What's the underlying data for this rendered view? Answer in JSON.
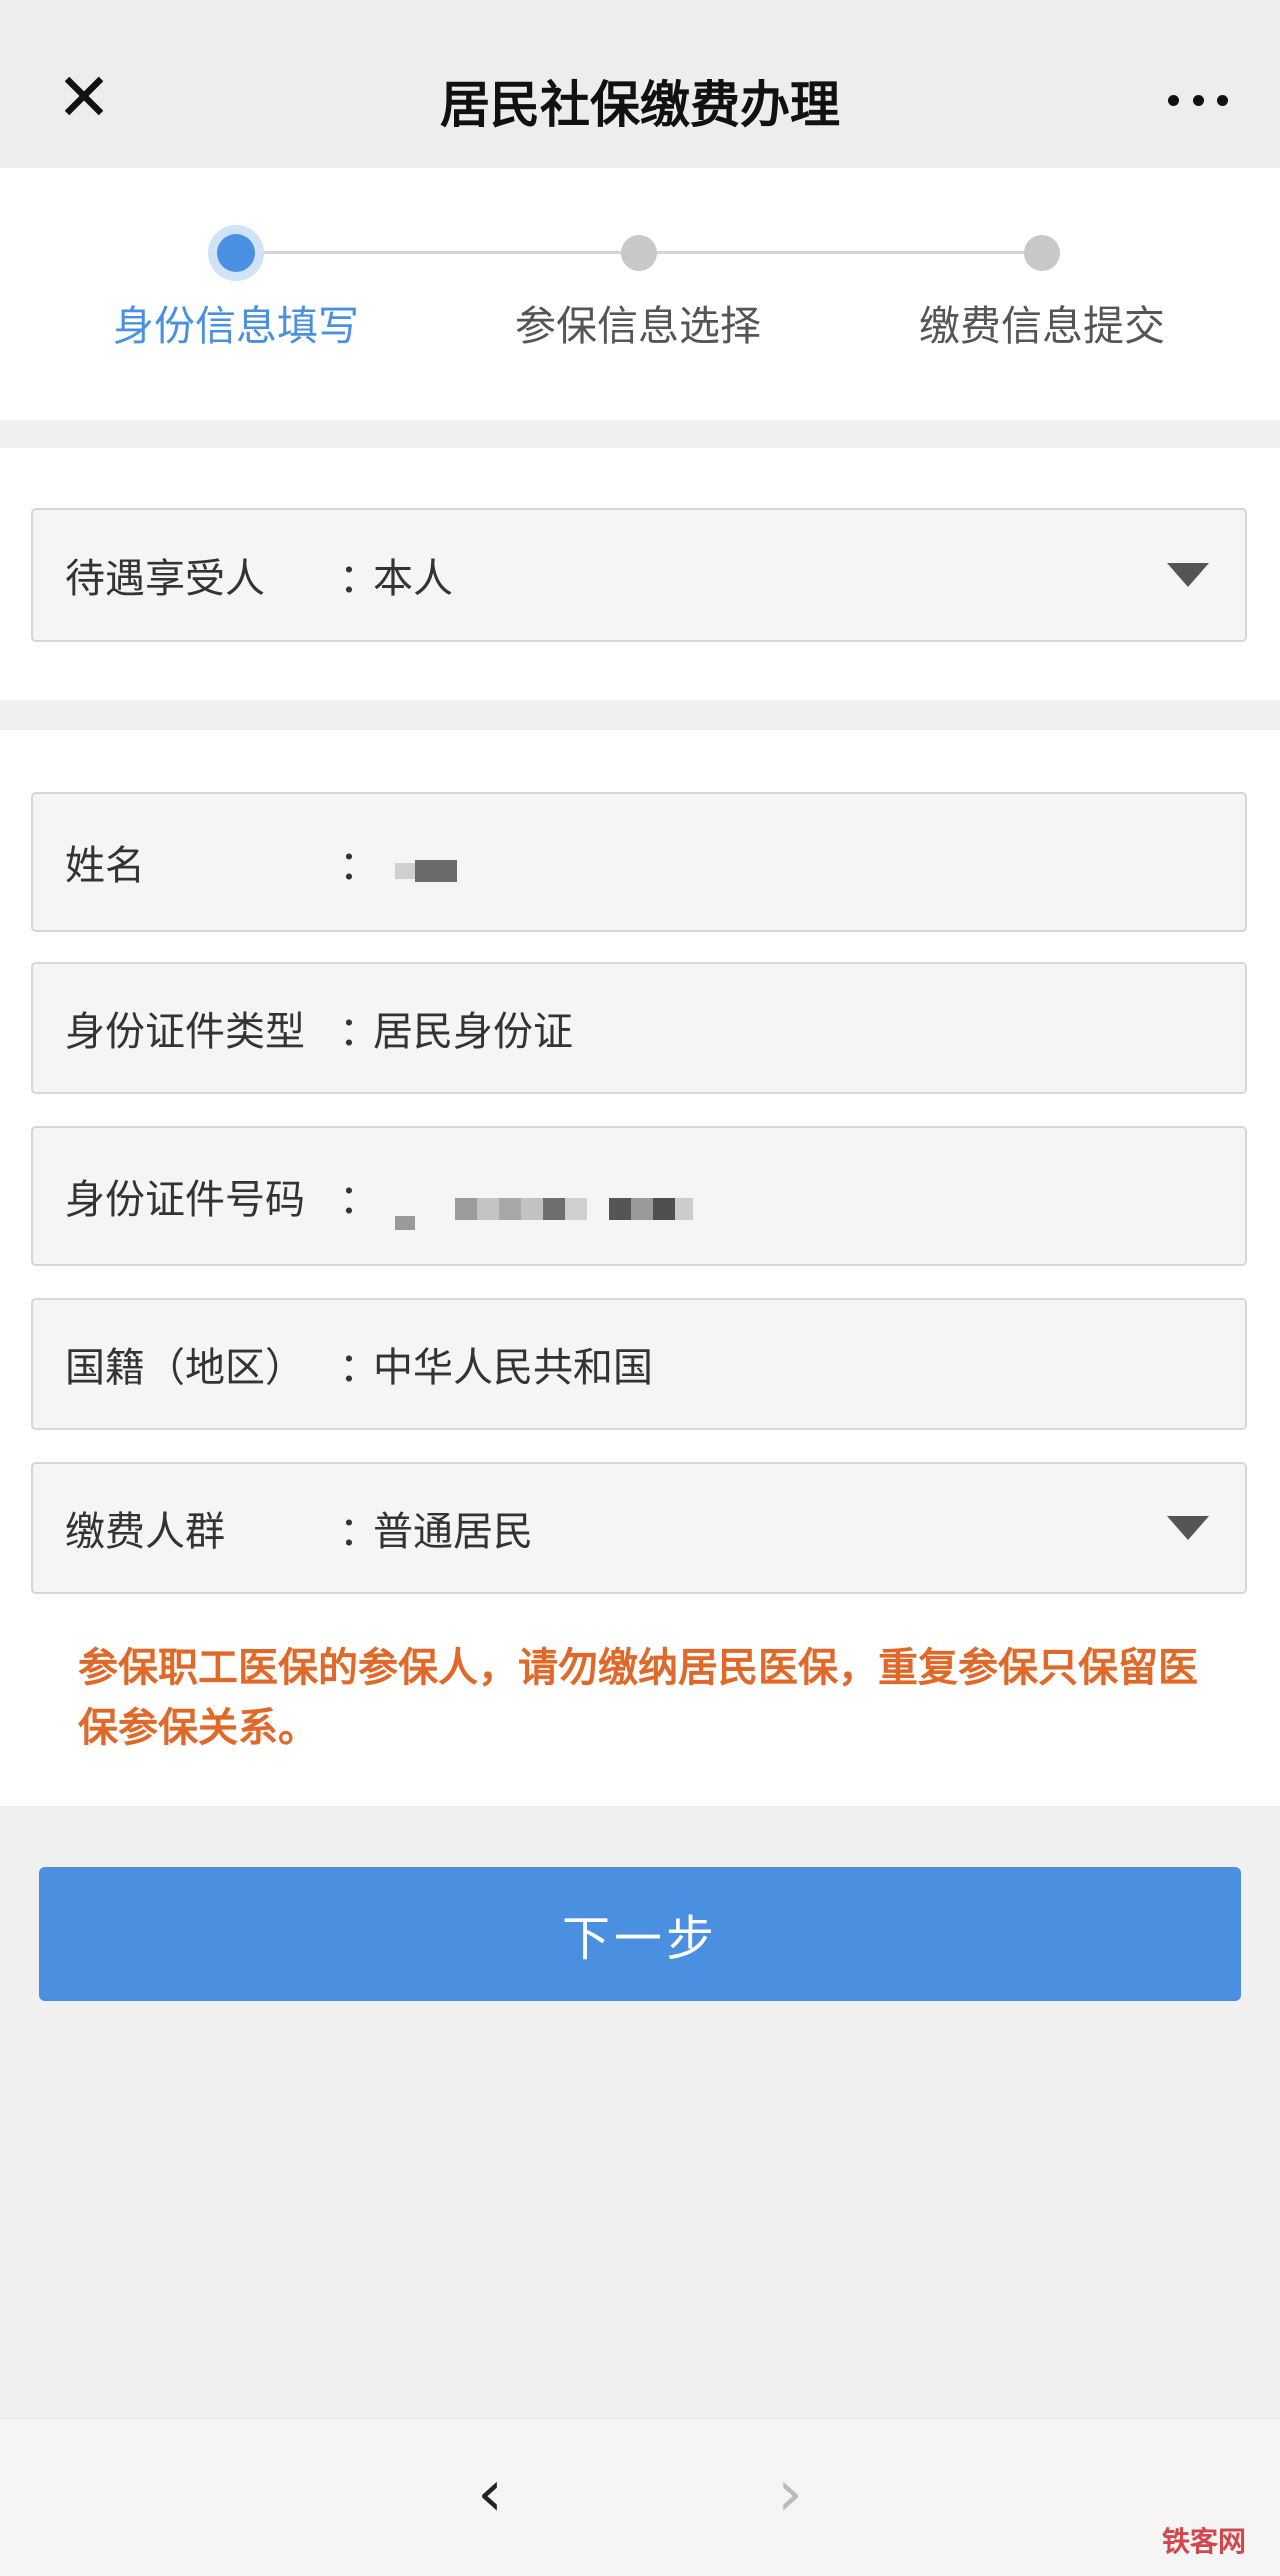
{
  "header": {
    "title": "居民社保缴费办理",
    "close_icon": "close-icon",
    "more_icon": "more-dots-icon"
  },
  "steps": [
    {
      "label": "身份信息填写",
      "active": true
    },
    {
      "label": "参保信息选择",
      "active": false
    },
    {
      "label": "缴费信息提交",
      "active": false
    }
  ],
  "beneficiary": {
    "label": "待遇享受人",
    "colon": "：",
    "value": "本人"
  },
  "form": {
    "name": {
      "label": "姓名",
      "colon": "：",
      "value": ""
    },
    "id_type": {
      "label": "身份证件类型",
      "colon": "：",
      "value": "居民身份证"
    },
    "id_number": {
      "label": "身份证件号码",
      "colon": "：",
      "value": ""
    },
    "nationality": {
      "label": "国籍（地区）",
      "colon": "：",
      "value": "中华人民共和国"
    },
    "payer_group": {
      "label": "缴费人群",
      "colon": "：",
      "value": "普通居民"
    }
  },
  "notice": "参保职工医保的参保人，请勿缴纳居民医保，重复参保只保留医保参保关系。",
  "next_button": "下一步",
  "watermark": "铁客网",
  "colors": {
    "accent": "#4a90e2",
    "button": "#4a8fe0",
    "notice": "#e0692a",
    "inactive_dot": "#c8c8c8"
  }
}
